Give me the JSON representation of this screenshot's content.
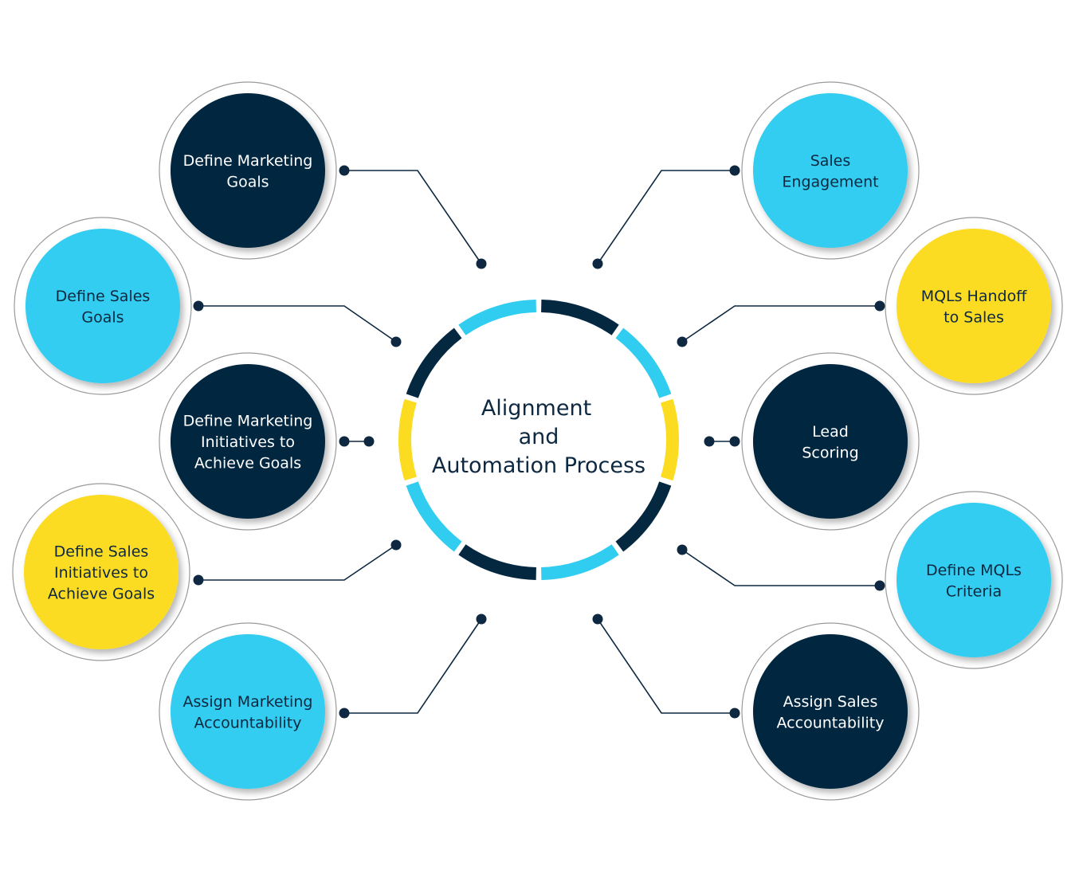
{
  "title": "Alignment and Automation Process",
  "center": {
    "lines": [
      "Alignment",
      "and",
      "Automation Process"
    ],
    "ring_segments": [
      "navy",
      "cyan",
      "yellow",
      "navy",
      "cyan",
      "navy",
      "cyan",
      "yellow",
      "navy",
      "cyan"
    ]
  },
  "colors": {
    "navy": "#052841",
    "cyan": "#30cdf0",
    "yellow": "#fcdc20",
    "text_dark": "#0d2840",
    "text_light": "#ffffff",
    "outline": "#9a9a9a",
    "connector": "#0d2840"
  },
  "nodes": [
    {
      "id": "define-marketing-goals",
      "lines": [
        "Define Marketing",
        "Goals"
      ],
      "color": "navy",
      "side": "left"
    },
    {
      "id": "define-sales-goals",
      "lines": [
        "Define Sales",
        "Goals"
      ],
      "color": "cyan",
      "side": "left"
    },
    {
      "id": "define-marketing-initiatives",
      "lines": [
        "Define Marketing",
        "Initiatives to",
        "Achieve Goals"
      ],
      "color": "navy",
      "side": "left"
    },
    {
      "id": "define-sales-initiatives",
      "lines": [
        "Define Sales",
        "Initiatives to",
        "Achieve Goals"
      ],
      "color": "yellow",
      "side": "left"
    },
    {
      "id": "assign-marketing-accountability",
      "lines": [
        "Assign Marketing",
        "Accountability"
      ],
      "color": "cyan",
      "side": "left"
    },
    {
      "id": "sales-engagement",
      "lines": [
        "Sales",
        "Engagement"
      ],
      "color": "cyan",
      "side": "right"
    },
    {
      "id": "mqls-handoff-to-sales",
      "lines": [
        "MQLs Handoff",
        "to Sales"
      ],
      "color": "yellow",
      "side": "right"
    },
    {
      "id": "lead-scoring",
      "lines": [
        "Lead",
        "Scoring"
      ],
      "color": "navy",
      "side": "right"
    },
    {
      "id": "define-mqls-criteria",
      "lines": [
        "Define MQLs",
        "Criteria"
      ],
      "color": "cyan",
      "side": "right"
    },
    {
      "id": "assign-sales-accountability",
      "lines": [
        "Assign Sales",
        "Accountability"
      ],
      "color": "navy",
      "side": "right"
    }
  ]
}
